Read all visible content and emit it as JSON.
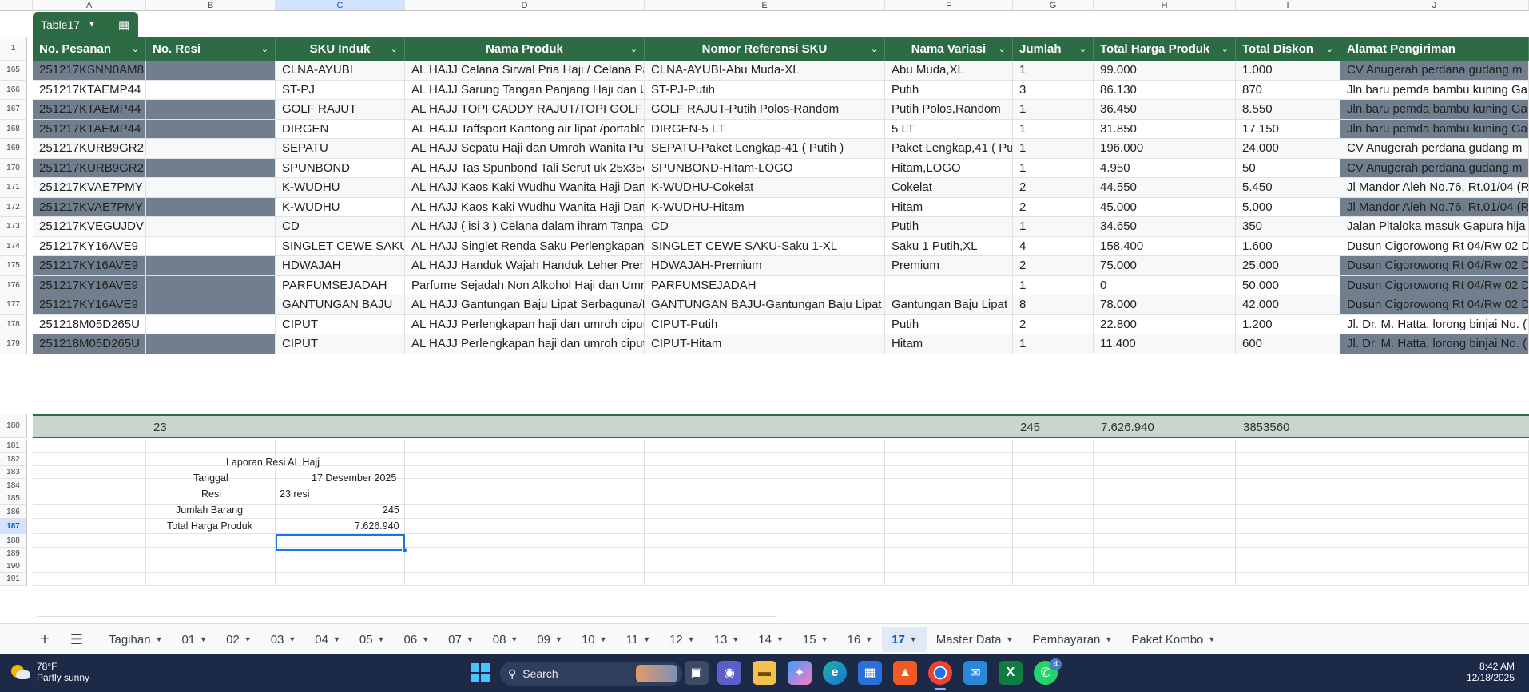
{
  "table_name": "Table17",
  "column_letters": [
    "A",
    "B",
    "C",
    "D",
    "E",
    "F",
    "G",
    "H",
    "I",
    "J"
  ],
  "header_row_num": "1",
  "headers": [
    "No. Pesanan",
    "No. Resi",
    "SKU Induk",
    "Nama Produk",
    "Nomor Referensi SKU",
    "Nama Variasi",
    "Jumlah",
    "Total Harga Produk",
    "Total Diskon",
    "Alamat Pengiriman"
  ],
  "rows": [
    {
      "n": "165",
      "a": "251217KSNN0AM8",
      "c": "CLNA-AYUBI",
      "d": "AL HAJJ Celana Sirwal Pria Haji / Celana Pa",
      "e": "CLNA-AYUBI-Abu Muda-XL",
      "f": "Abu Muda,XL",
      "g": "1",
      "h": "99.000",
      "i": "1.000",
      "j": "CV Anugerah perdana gudang m",
      "dark": true
    },
    {
      "n": "166",
      "a": "251217KTAEMP44",
      "c": "ST-PJ",
      "d": "AL HAJJ Sarung Tangan Panjang Haji dan U",
      "e": "ST-PJ-Putih",
      "f": "Putih",
      "g": "3",
      "h": "86.130",
      "i": "870",
      "j": "Jln.baru pemda bambu kuning Ga",
      "dark": false
    },
    {
      "n": "167",
      "a": "251217KTAEMP44",
      "c": "GOLF RAJUT",
      "d": "AL HAJJ TOPI CADDY RAJUT/TOPI GOLF F",
      "e": "GOLF RAJUT-Putih Polos-Random",
      "f": "Putih Polos,Random",
      "g": "1",
      "h": "36.450",
      "i": "8.550",
      "j": "Jln.baru pemda bambu kuning Ga",
      "dark": true
    },
    {
      "n": "168",
      "a": "251217KTAEMP44",
      "c": "DIRGEN",
      "d": "AL HAJJ Taffsport Kantong air lipat /portable",
      "e": "DIRGEN-5 LT",
      "f": "5 LT",
      "g": "1",
      "h": "31.850",
      "i": "17.150",
      "j": "Jln.baru pemda bambu kuning Ga",
      "dark": true
    },
    {
      "n": "169",
      "a": "251217KURB9GR2",
      "c": "SEPATU",
      "d": "AL HAJJ Sepatu Haji dan Umroh Wanita Puti",
      "e": "SEPATU-Paket Lengkap-41 ( Putih )",
      "f": "Paket Lengkap,41 ( Put",
      "g": "1",
      "h": "196.000",
      "i": "24.000",
      "j": "CV Anugerah perdana gudang m",
      "dark": false
    },
    {
      "n": "170",
      "a": "251217KURB9GR2",
      "c": "SPUNBOND",
      "d": "AL HAJJ Tas Spunbond Tali Serut uk 25x35c",
      "e": "SPUNBOND-Hitam-LOGO",
      "f": "Hitam,LOGO",
      "g": "1",
      "h": "4.950",
      "i": "50",
      "j": "CV Anugerah perdana gudang m",
      "dark": true
    },
    {
      "n": "171",
      "a": "251217KVAE7PMY",
      "c": "K-WUDHU",
      "d": "AL HAJJ Kaos Kaki Wudhu Wanita Haji Dan",
      "e": "K-WUDHU-Cokelat",
      "f": "Cokelat",
      "g": "2",
      "h": "44.550",
      "i": "5.450",
      "j": "Jl Mandor Aleh No.76, Rt.01/04 (R",
      "dark": false
    },
    {
      "n": "172",
      "a": "251217KVAE7PMY",
      "c": "K-WUDHU",
      "d": "AL HAJJ Kaos Kaki Wudhu Wanita Haji Dan",
      "e": "K-WUDHU-Hitam",
      "f": "Hitam",
      "g": "2",
      "h": "45.000",
      "i": "5.000",
      "j": "Jl Mandor Aleh No.76, Rt.01/04 (R",
      "dark": true
    },
    {
      "n": "173",
      "a": "251217KVEGUJDV",
      "c": "CD",
      "d": "AL HAJJ ( isi 3 ) Celana dalam ihram Tanpa J",
      "e": "CD",
      "f": "Putih",
      "g": "1",
      "h": "34.650",
      "i": "350",
      "j": "Jalan Pitaloka masuk Gapura hija",
      "dark": false
    },
    {
      "n": "174",
      "a": "251217KY16AVE9",
      "c": "SINGLET CEWE SAKU",
      "d": "AL HAJJ Singlet Renda Saku Perlengkapan I",
      "e": "SINGLET CEWE SAKU-Saku 1-XL",
      "f": "Saku 1 Putih,XL",
      "g": "4",
      "h": "158.400",
      "i": "1.600",
      "j": "Dusun Cigorowong Rt 04/Rw 02 D",
      "dark": false
    },
    {
      "n": "175",
      "a": "251217KY16AVE9",
      "c": "HDWAJAH",
      "d": "AL HAJJ Handuk Wajah Handuk Leher Prem",
      "e": "HDWAJAH-Premium",
      "f": "Premium",
      "g": "2",
      "h": "75.000",
      "i": "25.000",
      "j": "Dusun Cigorowong Rt 04/Rw 02 D",
      "dark": true
    },
    {
      "n": "176",
      "a": "251217KY16AVE9",
      "c": "PARFUMSEJADAH",
      "d": "Parfume Sejadah Non Alkohol Haji dan Umrc",
      "e": "PARFUMSEJADAH",
      "f": "",
      "g": "1",
      "h": "0",
      "i": "50.000",
      "j": "Dusun Cigorowong Rt 04/Rw 02 D",
      "dark": true
    },
    {
      "n": "177",
      "a": "251217KY16AVE9",
      "c": "GANTUNGAN BAJU",
      "d": "AL HAJJ Gantungan Baju Lipat Serbaguna/H",
      "e": "GANTUNGAN BAJU-Gantungan Baju Lipat",
      "f": "Gantungan Baju Lipat",
      "g": "8",
      "h": "78.000",
      "i": "42.000",
      "j": "Dusun Cigorowong Rt 04/Rw 02 D",
      "dark": true
    },
    {
      "n": "178",
      "a": "251218M05D265U",
      "c": "CIPUT",
      "d": "AL HAJJ Perlengkapan haji dan umroh ciput",
      "e": "CIPUT-Putih",
      "f": "Putih",
      "g": "2",
      "h": "22.800",
      "i": "1.200",
      "j": "Jl. Dr. M. Hatta. lorong binjai No. (",
      "dark": false
    },
    {
      "n": "179",
      "a": "251218M05D265U",
      "c": "CIPUT",
      "d": "AL HAJJ Perlengkapan haji dan umroh ciput",
      "e": "CIPUT-Hitam",
      "f": "Hitam",
      "g": "1",
      "h": "11.400",
      "i": "600",
      "j": "Jl. Dr. M. Hatta. lorong binjai No. (",
      "dark": true
    }
  ],
  "totals": {
    "n": "180",
    "b": "23",
    "g": "245",
    "h": "7.626.940",
    "i": "3853560"
  },
  "report": {
    "title": "Laporan Resi AL Hajj",
    "tanggal_label": "Tanggal",
    "tanggal_value": "17 Desember 2025",
    "resi_label": "Resi",
    "resi_value": "23 resi",
    "jumlah_label": "Jumlah Barang",
    "jumlah_value": "245",
    "total_label": "Total Harga Produk",
    "total_value": "7.626.940"
  },
  "empty_rows": [
    "181",
    "182",
    "183",
    "184",
    "185",
    "186",
    "187",
    "188",
    "189",
    "190",
    "191"
  ],
  "sheet_tabs": [
    "Tagihan",
    "01",
    "02",
    "03",
    "04",
    "05",
    "06",
    "07",
    "08",
    "09",
    "10",
    "11",
    "12",
    "13",
    "14",
    "15",
    "16",
    "17",
    "Master Data",
    "Pembayaran",
    "Paket Kombo"
  ],
  "active_tab": "17",
  "taskbar": {
    "weather_temp": "78°F",
    "weather_desc": "Partly sunny",
    "search_label": "Search",
    "time": "8:42 AM",
    "date": "12/18/2025",
    "whatsapp_badge": "4"
  },
  "colors": {
    "header_green": "#2d6b45",
    "dark_row": "#717e8e",
    "total_row": "#c8d6cd",
    "accent": "#1a73e8"
  }
}
